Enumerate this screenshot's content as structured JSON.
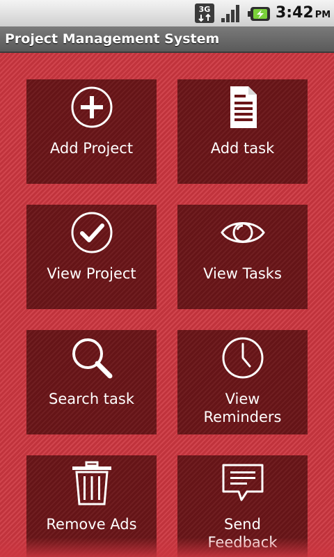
{
  "status_bar": {
    "network_label": "3G",
    "time": "3:42",
    "ampm": "PM"
  },
  "app": {
    "title": "Project Management System"
  },
  "tiles": [
    {
      "label": "Add Project",
      "icon": "plus-circle-icon"
    },
    {
      "label": "Add task",
      "icon": "document-icon"
    },
    {
      "label": "View Project",
      "icon": "check-circle-icon"
    },
    {
      "label": "View Tasks",
      "icon": "eye-icon"
    },
    {
      "label": "Search task",
      "icon": "search-icon"
    },
    {
      "label": "View\nReminders",
      "icon": "clock-icon"
    },
    {
      "label": "Remove Ads",
      "icon": "trash-icon"
    },
    {
      "label": "Send\nFeedback",
      "icon": "speech-bubble-icon"
    }
  ],
  "colors": {
    "background": "#cc3640",
    "tile": "#6a1518",
    "title_bar": "#6a6a6a",
    "text": "#ffffff"
  }
}
